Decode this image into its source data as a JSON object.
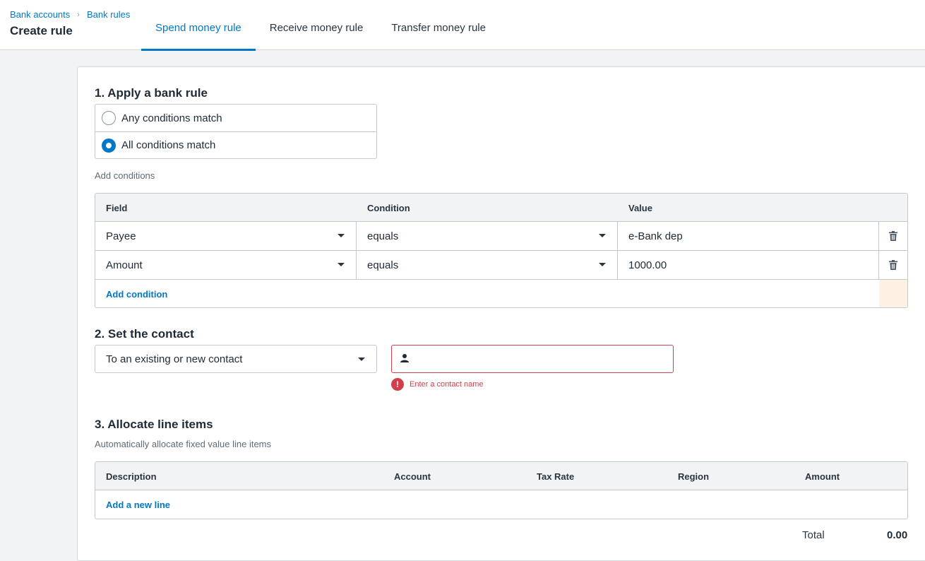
{
  "breadcrumb": {
    "items": [
      "Bank accounts",
      "Bank rules"
    ],
    "separator": "›"
  },
  "page_title": "Create rule",
  "tabs": [
    {
      "label": "Spend money rule",
      "active": true
    },
    {
      "label": "Receive money rule",
      "active": false
    },
    {
      "label": "Transfer money rule",
      "active": false
    }
  ],
  "section1": {
    "title": "1. Apply a bank rule",
    "options": [
      {
        "label": "Any conditions match",
        "selected": false
      },
      {
        "label": "All conditions match",
        "selected": true
      }
    ],
    "add_conditions_label": "Add conditions",
    "table": {
      "headers": [
        "Field",
        "Condition",
        "Value"
      ],
      "rows": [
        {
          "field": "Payee",
          "condition": "equals",
          "value": "e-Bank dep"
        },
        {
          "field": "Amount",
          "condition": "equals",
          "value": "1000.00"
        }
      ],
      "add_label": "Add condition"
    }
  },
  "section2": {
    "title": "2. Set the contact",
    "select_value": "To an existing or new contact",
    "contact_value": "",
    "error": "Enter a contact name"
  },
  "section3": {
    "title": "3. Allocate line items",
    "subtitle": "Automatically allocate fixed value line items",
    "headers": [
      "Description",
      "Account",
      "Tax Rate",
      "Region",
      "Amount"
    ],
    "add_label": "Add a new line",
    "total_label": "Total",
    "total_value": "0.00"
  },
  "colors": {
    "accent": "#0078c8",
    "error": "#d63d4b",
    "highlight": "#fdf1e3"
  },
  "icons": [
    "chevron-right-icon",
    "caret-down-icon",
    "trash-icon",
    "person-icon",
    "error-icon"
  ]
}
